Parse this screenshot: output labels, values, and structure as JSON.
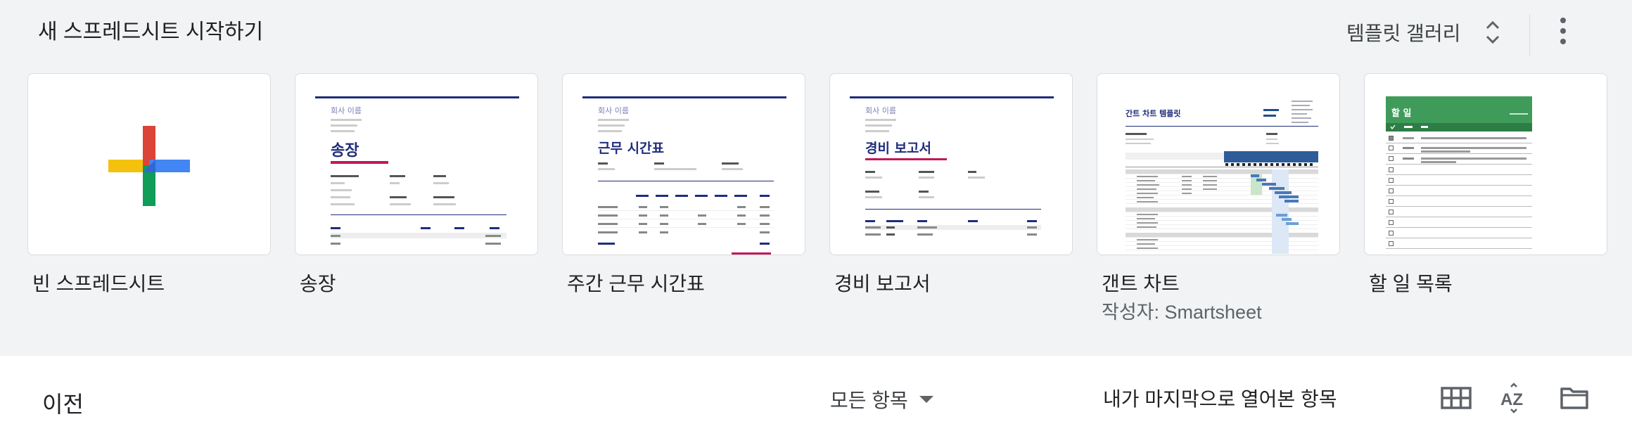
{
  "header": {
    "title": "새 스프레드시트 시작하기",
    "gallery_label": "템플릿 갤러리",
    "more_icon": "more-vert-icon"
  },
  "templates": [
    {
      "label": "빈 스프레드시트",
      "sublabel": ""
    },
    {
      "label": "송장",
      "sublabel": ""
    },
    {
      "label": "주간 근무 시간표",
      "sublabel": ""
    },
    {
      "label": "경비 보고서",
      "sublabel": ""
    },
    {
      "label": "갠트 차트",
      "sublabel": "작성자: Smartsheet"
    },
    {
      "label": "할 일 목록",
      "sublabel": ""
    }
  ],
  "thumbs": {
    "company_name": "회사 이름",
    "invoice_title": "송장",
    "timesheet_title": "근무 시간표",
    "expense_title": "경비 보고서",
    "gantt_title": "간트 차트 템플릿",
    "todo_title": "할 일"
  },
  "colors": {
    "navy": "#1f2d7b",
    "magenta": "#c2185b",
    "sheets_green": "#3f9b5a",
    "plus_red": "#db4437",
    "plus_blue": "#4285f4",
    "plus_yellow": "#f4b400",
    "plus_green": "#0f9d58"
  },
  "bottom": {
    "section": "이전",
    "owner_filter": "모든 항목",
    "sort_label": "내가 마지막으로 열어본 항목",
    "icons": [
      "grid-view-icon",
      "sort-az-icon",
      "folder-icon"
    ]
  }
}
